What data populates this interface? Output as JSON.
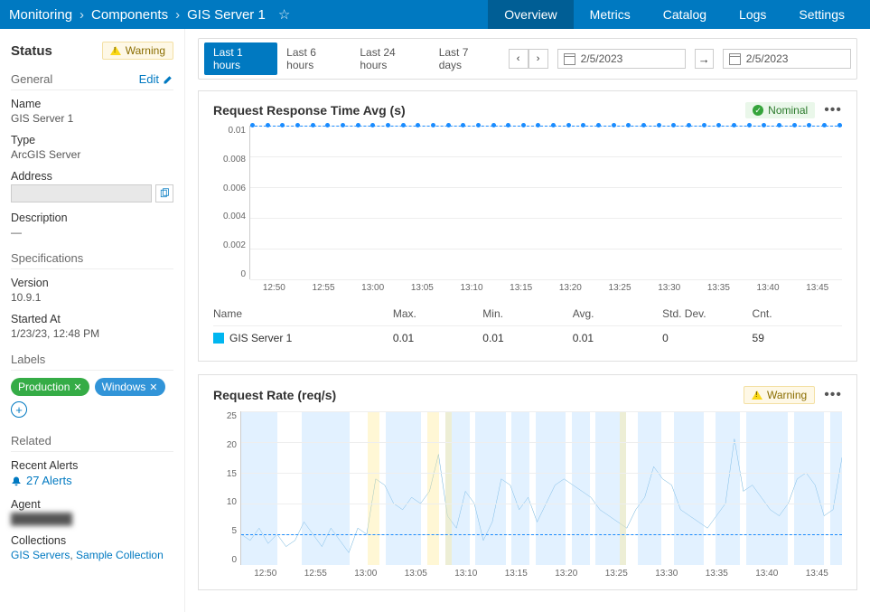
{
  "breadcrumb": [
    "Monitoring",
    "Components",
    "GIS Server 1"
  ],
  "nav": {
    "items": [
      "Overview",
      "Metrics",
      "Catalog",
      "Logs",
      "Settings"
    ],
    "active": "Overview"
  },
  "sidebar": {
    "status_label": "Status",
    "status_badge": "Warning",
    "general": {
      "title": "General",
      "edit": "Edit",
      "name_label": "Name",
      "name_value": "GIS Server 1",
      "type_label": "Type",
      "type_value": "ArcGIS Server",
      "address_label": "Address",
      "description_label": "Description",
      "description_value": "—"
    },
    "specs": {
      "title": "Specifications",
      "version_label": "Version",
      "version_value": "10.9.1",
      "started_label": "Started At",
      "started_value": "1/23/23, 12:48 PM"
    },
    "labels": {
      "title": "Labels",
      "items": [
        "Production",
        "Windows"
      ]
    },
    "related": {
      "title": "Related",
      "alerts_label": "Recent Alerts",
      "alerts_link": "27 Alerts",
      "agent_label": "Agent",
      "agent_value": "████████",
      "collections_label": "Collections",
      "collections_links": [
        "GIS Servers",
        "Sample Collection"
      ]
    }
  },
  "toolbar": {
    "ranges": [
      "Last 1 hours",
      "Last 6 hours",
      "Last 24 hours",
      "Last 7 days"
    ],
    "active_range": "Last 1 hours",
    "date_from": "2/5/2023",
    "date_to": "2/5/2023"
  },
  "chart_data": [
    {
      "type": "line",
      "title": "Request Response Time Avg (s)",
      "status": "Nominal",
      "ylabel": "",
      "ylim": [
        0,
        0.01
      ],
      "y_ticks": [
        "0.01",
        "0.008",
        "0.006",
        "0.004",
        "0.002",
        "0"
      ],
      "x_ticks": [
        "12:50",
        "12:55",
        "13:00",
        "13:05",
        "13:10",
        "13:15",
        "13:20",
        "13:25",
        "13:30",
        "13:35",
        "13:40",
        "13:45"
      ],
      "series": [
        {
          "name": "GIS Server 1",
          "value": 0.01,
          "points": 40
        }
      ],
      "table": {
        "headers": [
          "Name",
          "Max.",
          "Min.",
          "Avg.",
          "Std. Dev.",
          "Cnt."
        ],
        "rows": [
          {
            "name": "GIS Server 1",
            "max": "0.01",
            "min": "0.01",
            "avg": "0.01",
            "std": "0",
            "cnt": "59"
          }
        ]
      }
    },
    {
      "type": "line",
      "title": "Request Rate (req/s)",
      "status": "Warning",
      "ylim": [
        0,
        25
      ],
      "y_ticks": [
        "25",
        "20",
        "15",
        "10",
        "5",
        "0"
      ],
      "x_ticks": [
        "12:50",
        "12:55",
        "13:00",
        "13:05",
        "13:10",
        "13:15",
        "13:20",
        "13:25",
        "13:30",
        "13:35",
        "13:40",
        "13:45"
      ],
      "threshold": 5,
      "values": [
        5,
        4,
        6,
        3.5,
        5,
        3,
        4,
        7,
        5,
        3,
        6,
        4,
        2,
        6,
        5,
        14,
        13,
        10,
        9,
        11,
        10,
        12,
        18,
        8,
        6,
        12,
        10,
        4,
        7,
        14,
        13,
        9,
        11,
        7,
        10,
        13,
        14,
        13,
        12,
        11,
        9,
        8,
        7,
        6,
        9,
        11,
        16,
        14,
        13,
        9,
        8,
        7,
        6,
        8,
        10,
        20.5,
        12,
        13,
        11,
        9,
        8,
        10,
        14,
        15,
        13,
        8,
        9,
        17.5
      ]
    }
  ]
}
